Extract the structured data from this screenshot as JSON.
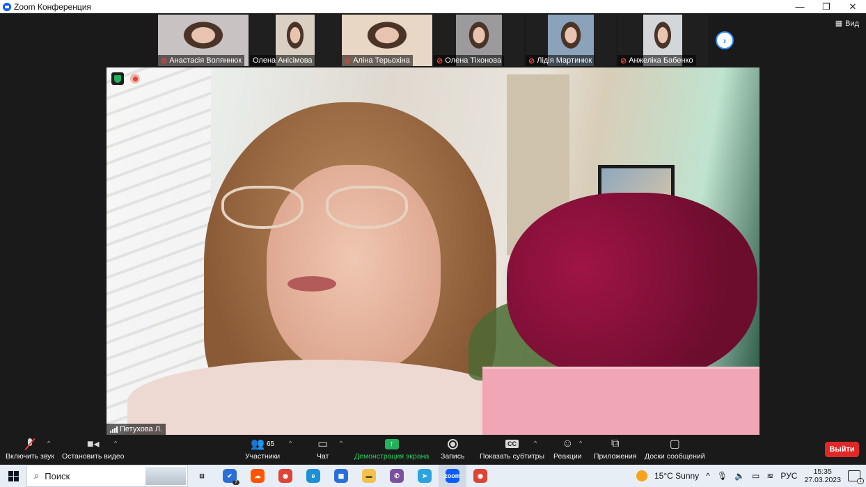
{
  "window": {
    "title": "Zoom Конференция",
    "controls": {
      "minimize": "—",
      "restore": "❐",
      "close": "✕"
    }
  },
  "view_button": {
    "label": "Вид"
  },
  "thumbnails": [
    {
      "name": "Анастасія Воляннюк",
      "muted": true,
      "bg": "#6f6a70",
      "photo_bg": "#c9c2c2"
    },
    {
      "name": "Олена Анісімова",
      "muted": false,
      "bg": "#1f1f1f",
      "photo_bg": "#d9cfc2"
    },
    {
      "name": "Аліна Терьохіна",
      "muted": true,
      "bg": "#b49d88",
      "photo_bg": "#e8d7c4"
    },
    {
      "name": "Олена Тіхонова",
      "muted": true,
      "bg": "#1f1f1f",
      "photo_bg": "#9c9a9c"
    },
    {
      "name": "Лідія Мартинюк",
      "muted": true,
      "bg": "#1f1f1f",
      "photo_bg": "#8aa2ba"
    },
    {
      "name": "Анжеліка Бабенко",
      "muted": true,
      "bg": "#1f1f1f",
      "photo_bg": "#d4d7da"
    }
  ],
  "active_speaker": {
    "name": "Петухова Л."
  },
  "toolbar": {
    "unmute": "Включить звук",
    "stop_video": "Остановить видео",
    "participants": "Участники",
    "participants_count": "65",
    "chat": "Чат",
    "share_screen": "Демонстрация экрана",
    "record": "Запись",
    "captions": "Показать субтитры",
    "captions_icon": "CC",
    "reactions": "Реакции",
    "apps": "Приложения",
    "whiteboards": "Доски сообщений",
    "leave": "Выйти"
  },
  "taskbar": {
    "search_placeholder": "Поиск",
    "apps": [
      {
        "name": "task-view-icon",
        "color": "#e8eef5",
        "glyph": "⊟",
        "fg": "#222"
      },
      {
        "name": "todo-app-icon",
        "color": "#2b6ed8",
        "glyph": "✔",
        "badge": "7"
      },
      {
        "name": "soundcloud-icon",
        "color": "#ff5500",
        "glyph": "☁"
      },
      {
        "name": "chrome-icon",
        "color": "#db4437",
        "glyph": "◉"
      },
      {
        "name": "edge-icon",
        "color": "#1d8fd6",
        "glyph": "e"
      },
      {
        "name": "store-icon",
        "color": "#2b6ed8",
        "glyph": "▦"
      },
      {
        "name": "file-explorer-icon",
        "color": "#f2c14e",
        "glyph": "▬",
        "fg": "#5a4a10"
      },
      {
        "name": "viber-icon",
        "color": "#7b519d",
        "glyph": "✆"
      },
      {
        "name": "telegram-icon",
        "color": "#2aa3de",
        "glyph": "➤"
      },
      {
        "name": "zoom-app-icon",
        "color": "#0b5cff",
        "glyph": "zoom",
        "active": true
      },
      {
        "name": "chrome-profile-icon",
        "color": "#db4437",
        "glyph": "◉"
      }
    ],
    "weather": "15°C  Sunny",
    "language": "РУС",
    "time": "15:35",
    "date": "27.03.2023",
    "notifications_count": "1"
  }
}
